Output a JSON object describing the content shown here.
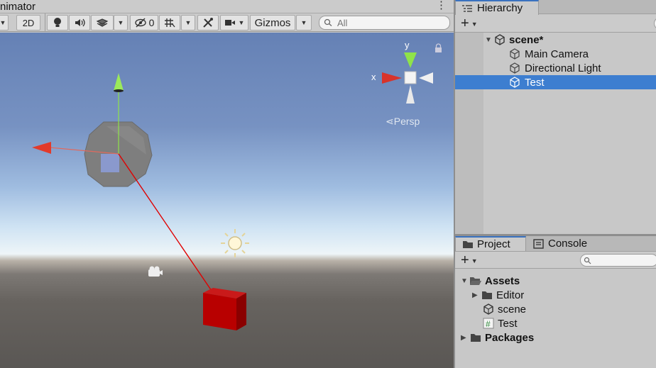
{
  "scene": {
    "tab_title": "nimator",
    "menu_glyph": "⋮",
    "toolbar": {
      "toggle_2d": "2D",
      "hidden_count": "0",
      "gizmos_label": "Gizmos",
      "search_placeholder": "All"
    },
    "gizmo_axes": {
      "x": "x",
      "y": "y"
    },
    "projection_label": "Persp"
  },
  "hierarchy": {
    "tab_title": "Hierarchy",
    "add_glyph": "+",
    "scene_name": "scene*",
    "items": [
      {
        "label": "Main Camera",
        "selected": false
      },
      {
        "label": "Directional Light",
        "selected": false
      },
      {
        "label": "Test",
        "selected": true
      }
    ]
  },
  "project": {
    "tabs": [
      {
        "label": "Project",
        "icon": "folder-icon",
        "active": true
      },
      {
        "label": "Console",
        "icon": "console-icon",
        "active": false
      }
    ],
    "add_glyph": "+",
    "tree": {
      "assets_label": "Assets",
      "children": [
        {
          "label": "Editor",
          "icon": "folder-icon"
        },
        {
          "label": "scene",
          "icon": "unity-scene-icon"
        },
        {
          "label": "Test",
          "icon": "csharp-script-icon"
        }
      ],
      "packages_label": "Packages"
    }
  },
  "colors": {
    "selection": "#3d7ed0",
    "axis_x": "#e23a2a",
    "axis_y": "#8fe34a",
    "cube": "#b30000"
  }
}
